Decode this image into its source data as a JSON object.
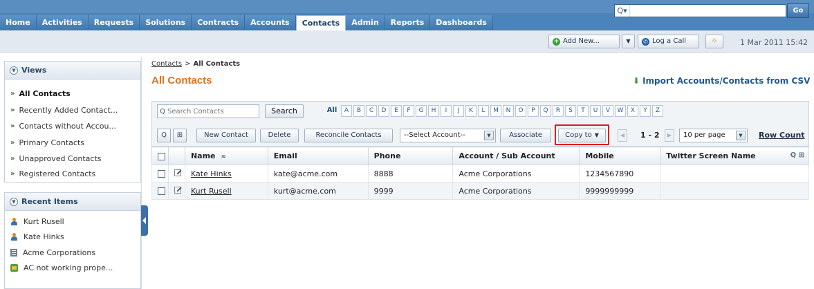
{
  "nav": {
    "tabs": [
      {
        "label": "Home",
        "active": false
      },
      {
        "label": "Activities",
        "active": false
      },
      {
        "label": "Requests",
        "active": false
      },
      {
        "label": "Solutions",
        "active": false
      },
      {
        "label": "Contracts",
        "active": false
      },
      {
        "label": "Accounts",
        "active": false
      },
      {
        "label": "Contacts",
        "active": true
      },
      {
        "label": "Admin",
        "active": false
      },
      {
        "label": "Reports",
        "active": false
      },
      {
        "label": "Dashboards",
        "active": false
      }
    ],
    "search_placeholder": "",
    "go_label": "Go"
  },
  "subbar": {
    "add_new_label": "Add New...",
    "log_call_label": "Log a Call",
    "datetime": "1 Mar 2011 15:42"
  },
  "views": {
    "title": "Views",
    "items": [
      {
        "label": "All Contacts",
        "selected": true
      },
      {
        "label": "Recently Added Contact..."
      },
      {
        "label": "Contacts without Accou..."
      },
      {
        "label": "Primary Contacts"
      },
      {
        "label": "Unapproved Contacts"
      },
      {
        "label": "Registered Contacts"
      }
    ]
  },
  "recent": {
    "title": "Recent Items",
    "items": [
      {
        "label": "Kurt Rusell",
        "icon": "person-icon"
      },
      {
        "label": "Kate Hinks",
        "icon": "person-icon"
      },
      {
        "label": "Acme Corporations",
        "icon": "building-icon"
      },
      {
        "label": "AC not working prope...",
        "icon": "request-icon"
      }
    ]
  },
  "breadcrumb": {
    "parent": "Contacts",
    "separator": ">",
    "current": "All Contacts"
  },
  "page_title": "All Contacts",
  "import_link": "Import Accounts/Contacts from CSV",
  "filter": {
    "search_placeholder": "Search Contacts",
    "search_button": "Search",
    "all_label": "All",
    "letters": [
      "A",
      "B",
      "C",
      "D",
      "E",
      "F",
      "G",
      "H",
      "I",
      "J",
      "K",
      "L",
      "M",
      "N",
      "O",
      "P",
      "Q",
      "R",
      "S",
      "T",
      "U",
      "V",
      "W",
      "X",
      "Y",
      "Z"
    ]
  },
  "toolbar": {
    "new_contact": "New Contact",
    "delete": "Delete",
    "reconcile": "Reconcile Contacts",
    "select_account": "--Select Account--",
    "associate": "Associate",
    "copy_to": "Copy to",
    "page_info": "1 - 2",
    "per_page": "10 per page",
    "row_count": "Row Count"
  },
  "table": {
    "columns": [
      "Name",
      "Email",
      "Phone",
      "Account / Sub Account",
      "Mobile",
      "Twitter Screen Name"
    ],
    "rows": [
      {
        "name": "Kate Hinks",
        "email": "kate@acme.com",
        "phone": "8888",
        "account": "Acme Corporations",
        "mobile": "1234567890",
        "twitter": ""
      },
      {
        "name": "Kurt Rusell",
        "email": "kurt@acme.com",
        "phone": "9999",
        "account": "Acme Corporations",
        "mobile": "9999999999",
        "twitter": ""
      }
    ]
  },
  "colors": {
    "nav_blue": "#4b83bb",
    "title_orange": "#e0701d",
    "link_blue": "#1c5a94",
    "highlight_red": "#e01b1b"
  }
}
